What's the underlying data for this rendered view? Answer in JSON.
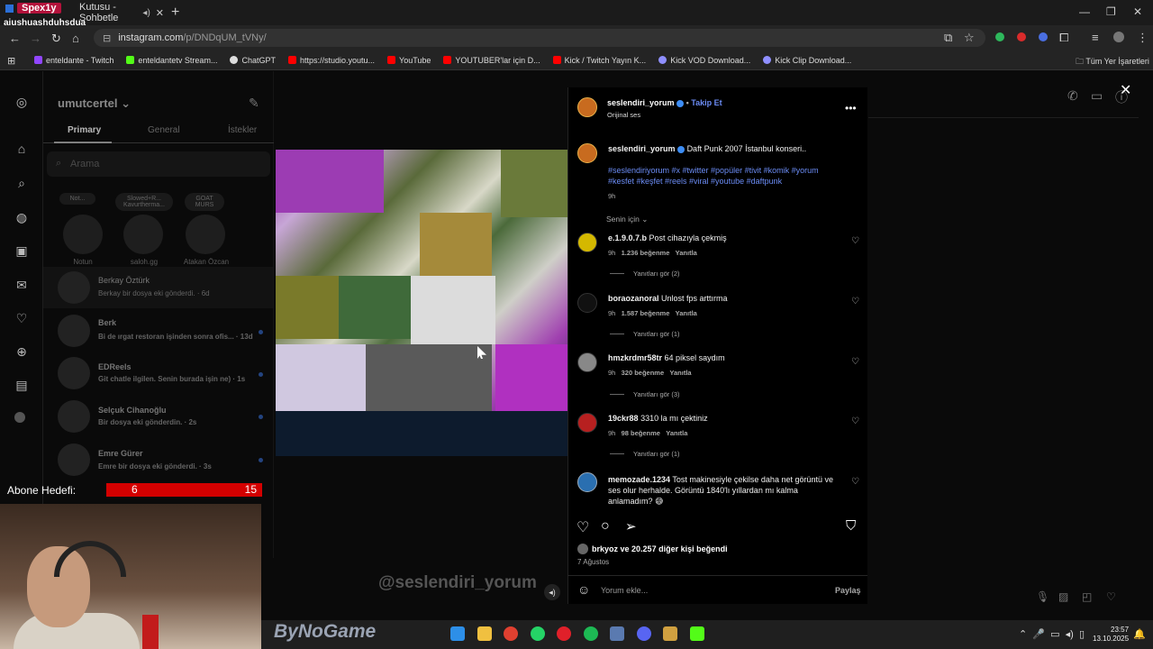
{
  "browser": {
    "tab_title": "Kutusu - Sohbetle",
    "url_domain": "instagram.com",
    "url_path": "/p/DNDqUM_tVNy/",
    "bookmarks": [
      {
        "label": "enteldante - Twitch",
        "color": "#9146ff"
      },
      {
        "label": "enteldantetv Stream...",
        "color": "#53fc18"
      },
      {
        "label": "ChatGPT",
        "color": "#dddddd"
      },
      {
        "label": "https://studio.youtu...",
        "color": "#ff0000"
      },
      {
        "label": "YouTube",
        "color": "#ff0000"
      },
      {
        "label": "YOUTUBER'lar için D...",
        "color": "#ff0000"
      },
      {
        "label": "Kick / Twitch Yayın K...",
        "color": "#ff0000"
      },
      {
        "label": "Kick VOD Download...",
        "color": "#8f8fff"
      },
      {
        "label": "Kick Clip Download...",
        "color": "#8f8fff"
      }
    ],
    "all_bookmarks": "Tüm Yer İşaretleri"
  },
  "stream_overlay": {
    "viewer_tag": "Spex1y",
    "chat_user": "aiushuashduhsdua",
    "goal_label": "Abone Hedefi:",
    "goal_current": "6",
    "goal_max": "15",
    "brand": "ByNoGame"
  },
  "dm": {
    "account": "umutcertel",
    "tabs": {
      "primary": "Primary",
      "general": "General",
      "requests": "İstekler"
    },
    "search_placeholder": "Arama",
    "notes": [
      {
        "label": "Notun",
        "bubble": "Not..."
      },
      {
        "label": "saloh.gg",
        "bubble": "Slowed+R... Kavurtherma..."
      },
      {
        "label": "Atakan Özcan",
        "bubble": "GOAT MURS"
      }
    ],
    "conversations": [
      {
        "name": "Berkay Öztürk",
        "msg": "Berkay bir dosya eki gönderdi. · 6d"
      },
      {
        "name": "Berk",
        "msg": "Bi de ırgat restoran işinden sonra ofis... · 13d"
      },
      {
        "name": "EDReels",
        "msg": "Git chatle ilgilen. Senin burada işin ne) · 1s"
      },
      {
        "name": "Selçuk Cihanoğlu",
        "msg": "Bir dosya eki gönderdin. · 2s"
      },
      {
        "name": "Emre Gürer",
        "msg": "Emre bir dosya eki gönderdi. · 3s"
      }
    ]
  },
  "video": {
    "watermark": "@seslendiri_yorum"
  },
  "post": {
    "author": "seslendiri_yorum",
    "follow": "Takip Et",
    "audio": "Orijinal ses",
    "caption": "Daft Punk 2007 İstanbul konseri..",
    "hashtags": "#seslendiriyorum #x #twitter #popüler #tivit #komik #yorum #kesfet #keşfet #reels #viral #youtube #daftpunk",
    "caption_time": "9h",
    "sort_label": "Senin için",
    "comments": [
      {
        "user": "e.1.9.0.7.b",
        "text": "Post cihazıyla çekmiş",
        "time": "9h",
        "likes": "1.236 beğenme",
        "reply": "Yanıtla",
        "view_replies": "Yanıtları gör (2)"
      },
      {
        "user": "boraozanoral",
        "text": "Unlost fps arttırma",
        "time": "9h",
        "likes": "1.587 beğenme",
        "reply": "Yanıtla",
        "view_replies": "Yanıtları gör (1)"
      },
      {
        "user": "hmzkrdmr58tr",
        "text": "64 piksel saydım",
        "time": "9h",
        "likes": "320 beğenme",
        "reply": "Yanıtla",
        "view_replies": "Yanıtları gör (3)"
      },
      {
        "user": "19ckr88",
        "text": "3310 la mı çektiniz",
        "time": "9h",
        "likes": "98 beğenme",
        "reply": "Yanıtla",
        "view_replies": "Yanıtları gör (1)"
      },
      {
        "user": "memozade.1234",
        "text": "Tost makinesiyle çekilse daha net görüntü ve ses olur herhalde. Görüntü 1840'lı yıllardan mı kalma anlamadım? 😅"
      }
    ],
    "likes_user": "brkyoz",
    "likes_rest": "ve 20.257 diğer kişi beğendi",
    "date": "7 Ağustos",
    "comment_placeholder": "Yorum ekle...",
    "share": "Paylaş"
  },
  "taskbar": {
    "time": "23:57",
    "date": "13.10.2025"
  }
}
